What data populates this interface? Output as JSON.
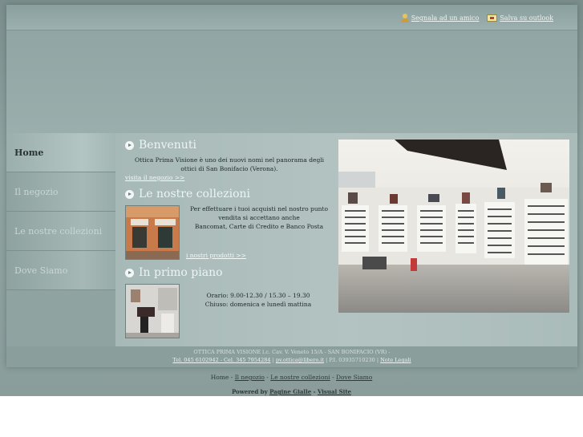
{
  "header": {
    "tell_friend_label": "Segnala ad un amico",
    "save_outlook_label": "Salva su outlook"
  },
  "sidebar": {
    "items": [
      {
        "label": "Home",
        "active": true
      },
      {
        "label": "Il negozio",
        "active": false
      },
      {
        "label": "Le nostre collezioni",
        "active": false
      },
      {
        "label": "Dove Siamo",
        "active": false
      }
    ]
  },
  "main": {
    "welcome": {
      "title": "Benvenuti",
      "text": "Ottica Prima Visione è uno dei nuovi  nomi nel panorama degli ottici di San Bonifacio (Verona).",
      "link": "visita il negozio >>"
    },
    "collections": {
      "title": "Le nostre collezioni",
      "text_line1": "Per effettuare i tuoi acquisti nel nostro punto vendita si accettano anche",
      "text_line2": "Bancomat, Carte di Credito e Banco Posta",
      "link": "i nostri prodotti >>"
    },
    "first_floor": {
      "title": "In primo piano",
      "hours": "Orario: 9.00-12.30 / 15.30 – 19.30",
      "closed": "Chiuso: domenica e lunedì mattina"
    }
  },
  "footer": {
    "company_line": "OTTICA PRIMA VISIONE l.c. Cav. V. Veneto 15/A - SAN BONIFACIO (VR) -",
    "phone": "Tel. 045 6102942 - Cel. 345 7954284",
    "email": "pv.ottica@libero.it",
    "vat": "P.I. 03935710230",
    "legal_link": "Note Legali",
    "sep": "|",
    "nav": {
      "home": "Home",
      "negozio": "Il negozio",
      "collezioni": "Le nostre collezioni",
      "dove": "Dove Siamo",
      "dash": "-"
    },
    "powered_label": "Powered by",
    "pagine_gialle": "Pagine Gialle",
    "visual_site": "Visual Site"
  }
}
